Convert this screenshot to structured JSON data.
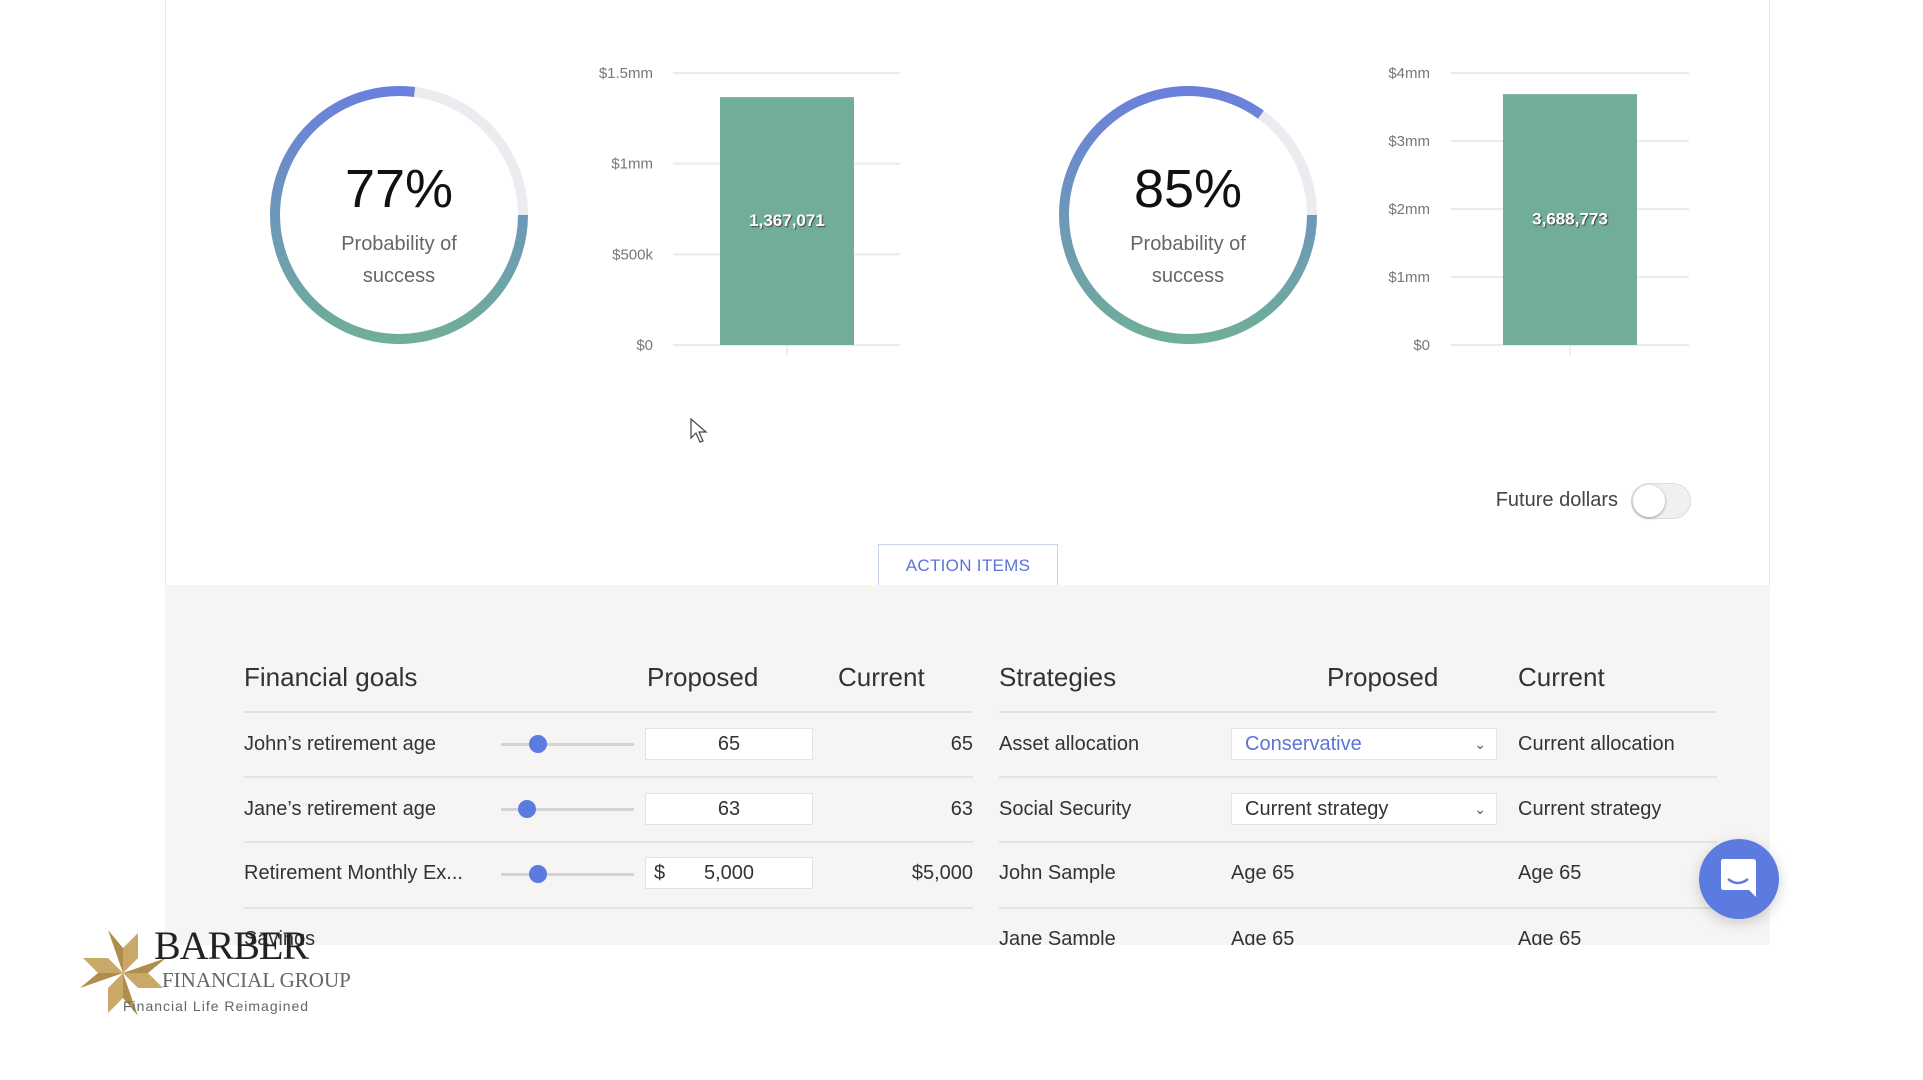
{
  "summary": [
    {
      "percent": 77,
      "percent_label": "77%",
      "caption_line1": "Probability of",
      "caption_line2": "success"
    },
    {
      "percent": 85,
      "percent_label": "85%",
      "caption_line1": "Probability of",
      "caption_line2": "success"
    }
  ],
  "colors": {
    "arc_top": "#6a80dc",
    "arc_bottom": "#6fae98",
    "arc_track": "#ececf0",
    "bar": "#72ad98",
    "accent": "#5b7be0"
  },
  "chart_data": [
    {
      "type": "bar",
      "categories": [
        ""
      ],
      "values": [
        1367071
      ],
      "data_labels": [
        "1,367,071"
      ],
      "ylim": [
        0,
        1500000
      ],
      "yticks": [
        0,
        500000,
        1000000,
        1500000
      ],
      "ytick_labels": [
        "$0",
        "$500k",
        "$1mm",
        "$1.5mm"
      ],
      "grid": true
    },
    {
      "type": "bar",
      "categories": [
        ""
      ],
      "values": [
        3688773
      ],
      "data_labels": [
        "3,688,773"
      ],
      "ylim": [
        0,
        4000000
      ],
      "yticks": [
        0,
        1000000,
        2000000,
        3000000,
        4000000
      ],
      "ytick_labels": [
        "$0",
        "$1mm",
        "$2mm",
        "$3mm",
        "$4mm"
      ],
      "grid": true
    }
  ],
  "future_dollars": {
    "label": "Future dollars",
    "on": false
  },
  "action_items_label": "ACTION ITEMS",
  "goals": {
    "headers": {
      "title": "Financial goals",
      "proposed": "Proposed",
      "current": "Current"
    },
    "rows": [
      {
        "label": "John’s retirement age",
        "slider_fraction": 0.3,
        "prefix": "",
        "proposed": "65",
        "current": "65"
      },
      {
        "label": "Jane’s retirement age",
        "slider_fraction": 0.2,
        "prefix": "",
        "proposed": "63",
        "current": "63"
      },
      {
        "label": "Retirement Monthly Ex...",
        "slider_fraction": 0.3,
        "prefix": "$",
        "proposed": "5,000",
        "current": "$5,000"
      },
      {
        "label": "Savings"
      }
    ]
  },
  "strategies": {
    "headers": {
      "title": "Strategies",
      "proposed": "Proposed",
      "current": "Current"
    },
    "rows": [
      {
        "label": "Asset allocation",
        "proposed": "Conservative",
        "current": "Current allocation"
      },
      {
        "label": "Social Security",
        "proposed": "Current strategy",
        "current": "Current strategy"
      },
      {
        "label": "John Sample",
        "proposed": "Age 65",
        "current": "Age 65"
      },
      {
        "label": "Jane Sample",
        "proposed": "Age 65",
        "current": "Age 65"
      }
    ]
  },
  "logo": {
    "name": "BARBER",
    "sub": "FINANCIAL GROUP",
    "tagline": "Financial Life Reimagined"
  }
}
